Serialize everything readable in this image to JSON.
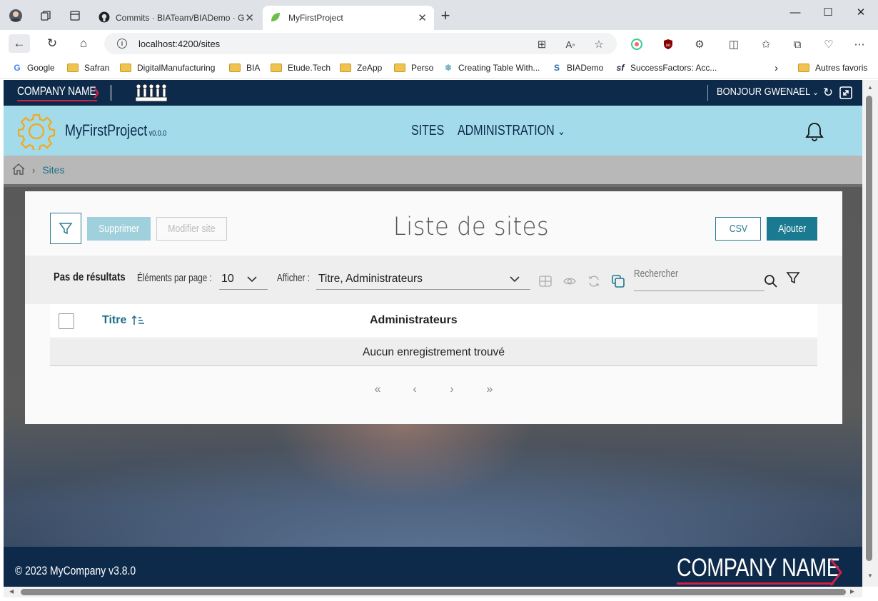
{
  "browser": {
    "tabs": [
      {
        "title": "Commits · BIATeam/BIADemo · G",
        "active": false
      },
      {
        "title": "MyFirstProject",
        "active": true
      }
    ],
    "url": "localhost:4200/sites",
    "bookmarks": [
      {
        "label": "Google",
        "icon": "google-icon"
      },
      {
        "label": "Safran",
        "icon": "folder-icon"
      },
      {
        "label": "DigitalManufacturing",
        "icon": "folder-icon"
      },
      {
        "label": "BIA",
        "icon": "folder-icon"
      },
      {
        "label": "Etude.Tech",
        "icon": "folder-icon"
      },
      {
        "label": "ZeApp",
        "icon": "folder-icon"
      },
      {
        "label": "Perso",
        "icon": "folder-icon"
      },
      {
        "label": "Creating Table With...",
        "icon": "page-icon"
      },
      {
        "label": "BIADemo",
        "icon": "s-icon"
      },
      {
        "label": "SuccessFactors: Acc...",
        "icon": "sf-icon"
      }
    ],
    "other_bookmarks": "Autres favoris"
  },
  "header": {
    "company_logo": "COMPANY NAME",
    "greeting": "BONJOUR GWENAEL",
    "brand_color": "#0d2a4a",
    "accent_color": "#d11f45"
  },
  "menubar": {
    "project_name": "MyFirstProject",
    "version": "v0.0.0",
    "items": [
      "SITES",
      "ADMINISTRATION"
    ],
    "background": "#a4dbea"
  },
  "breadcrumb": {
    "current": "Sites"
  },
  "page": {
    "title": "Liste de sites",
    "delete_label": "Supprimer",
    "edit_label": "Modifier site",
    "csv_label": "CSV",
    "add_label": "Ajouter"
  },
  "toolbar": {
    "results": "Pas de résultats",
    "per_page_label": "Éléments par page :",
    "per_page_value": "10",
    "display_label": "Afficher :",
    "display_value": "Titre, Administrateurs",
    "search_placeholder": "Rechercher"
  },
  "table": {
    "columns": [
      "Titre",
      "Administrateurs"
    ],
    "sorted_column": "Titre",
    "empty_message": "Aucun enregistrement trouvé"
  },
  "footer": {
    "copyright": "© 2023 MyCompany v3.8.0",
    "logo": "COMPANY NAME"
  }
}
